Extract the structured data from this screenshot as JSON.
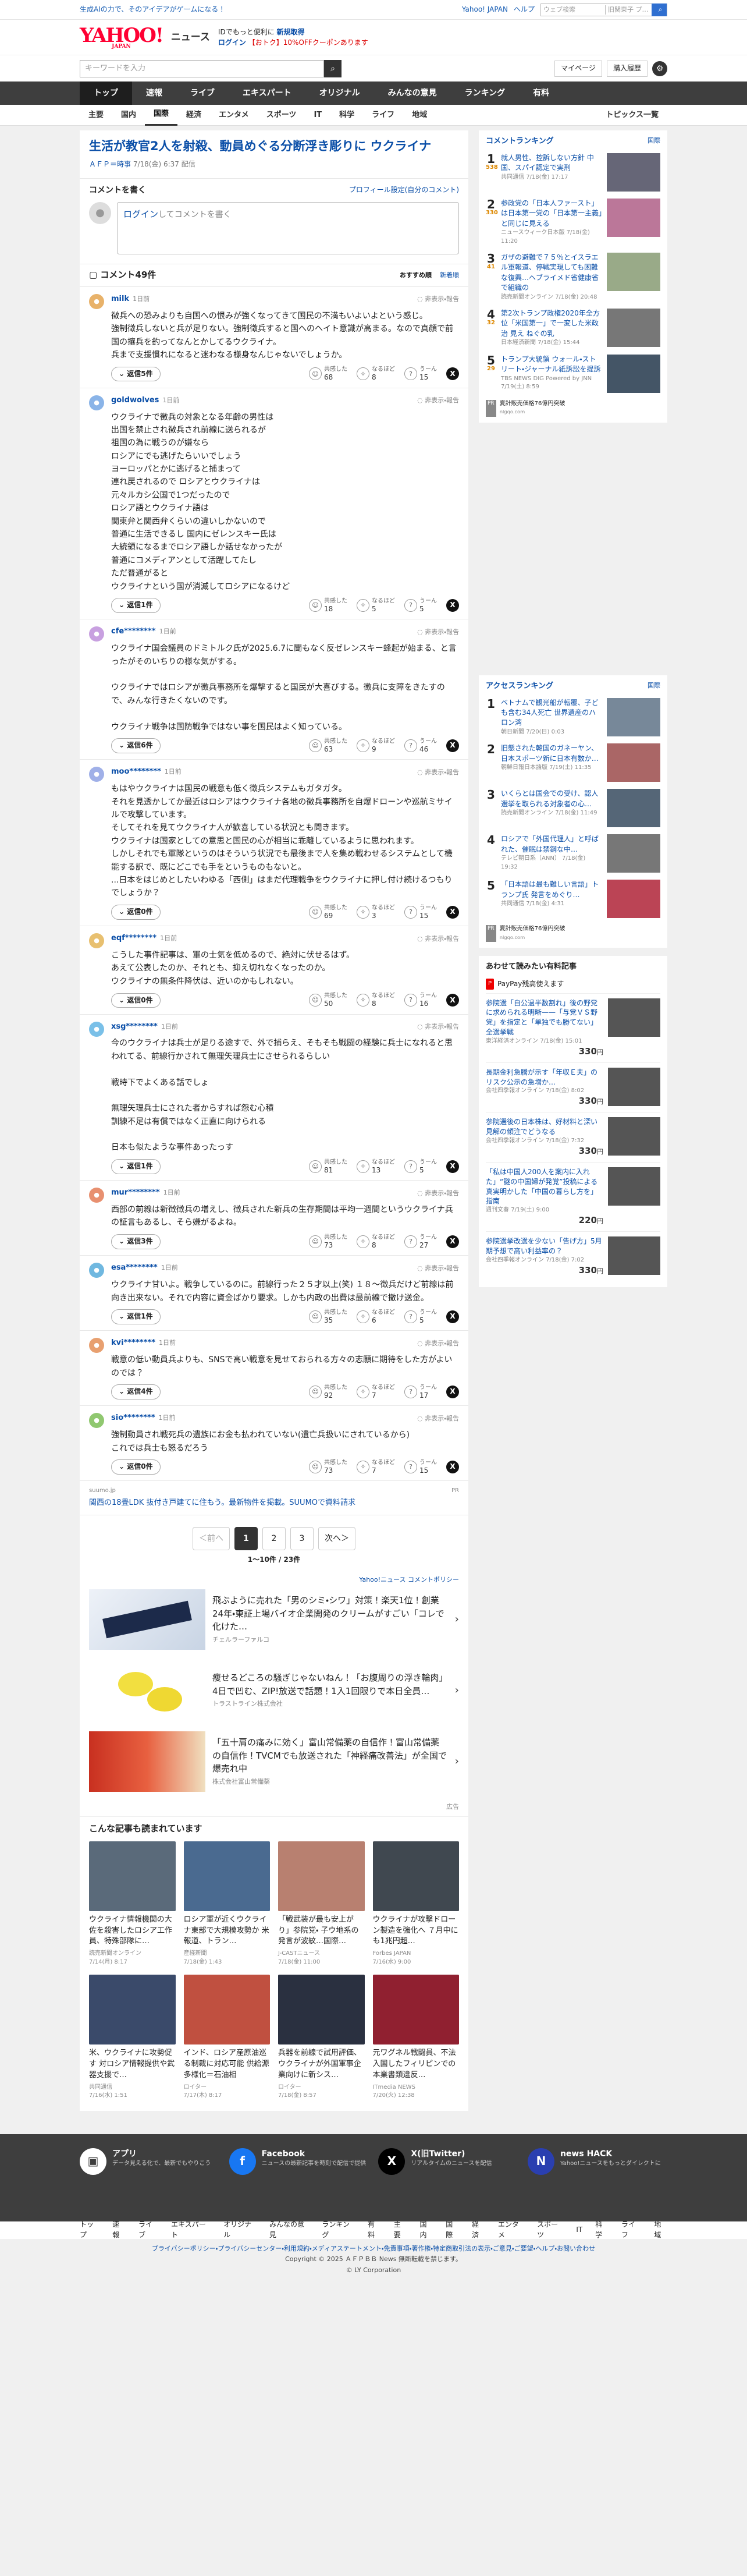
{
  "topbar": {
    "promo": "生成AIの力で、そのアイデアがゲームになる！",
    "yj": "Yahoo! JAPAN",
    "help": "ヘルプ",
    "search_placeholder": "ウェブ検索",
    "search_placeholder2": "旧関東子 プ…"
  },
  "header": {
    "logo": "YAHOO!",
    "logo_sub_small": "JAPAN",
    "service": "ニュース",
    "line1_a": "IDでもっと便利に",
    "line1_b": "新規取得",
    "line2_a": "ログイン",
    "line2_b": "【おトク】10%OFFクーポンあります"
  },
  "searchrow": {
    "placeholder": "キーワードを入力",
    "mypage": "マイページ",
    "buy": "購入履歴",
    "icons": {
      "search": "search-icon",
      "gear": "gear-icon"
    }
  },
  "nav": [
    "トップ",
    "速報",
    "ライブ",
    "エキスパート",
    "オリジナル",
    "みんなの意見",
    "ランキング",
    "有料"
  ],
  "subnav": [
    "主要",
    "国内",
    "国際",
    "経済",
    "エンタメ",
    "スポーツ",
    "IT",
    "科学",
    "ライフ",
    "地域"
  ],
  "subnav_more": "トピックス一覧",
  "article": {
    "title": "生活が教官2人を射殺、動員めぐる分断浮き彫りに ウクライナ",
    "source": "ＡＦＰ＝時事",
    "time": "7/18(金) 6:37 配信"
  },
  "comment_write": {
    "title": "コメントを書く",
    "profile": "プロフィール設定(自分のコメント)",
    "login": "ログイン",
    "rest": "してコメントを書く"
  },
  "clist": {
    "count": "コメント49件",
    "sort1": "おすすめ順",
    "sort2": "新着順"
  },
  "labels": {
    "reply": "返信",
    "report": "非表示・報告",
    "r1": "共感した",
    "r2": "なるほど",
    "r3": "うーん"
  },
  "comments": [
    {
      "name": "milk",
      "ago": "1日前",
      "text": "徴兵への恐みよりも自国への恨みが強くなってきて国民の不満もいよいよという感じ。\n強制徴兵しないと兵が足りない。強制徴兵すると国へのヘイト意識が高まる。なので真顔で前国の攘兵を釣ってなんとかしてるウクライナ。\n兵まで支援慣れになると迷わなる様身なんじゃないでしょうか。",
      "replies": "返信5件",
      "a": "68",
      "b": "8",
      "c": "15",
      "color": "#e8b26a"
    },
    {
      "name": "goldwolves",
      "ago": "1日前",
      "text": "ウクライナで徴兵の対象となる年齢の男性は\n出国を禁止され徴兵され前線に送られるが\n祖国の為に戦うのが嫌なら\nロシアにでも逃げたらいいでしょう\nヨーロッパとかに逃げると捕まって\n連れ戻されるので ロシアとウクライナは\n元々ルカシ公国で1つだったので\nロシア語とウクライナ語は\n関東弁と関西弁くらいの違いしかないので\n普通に生活できるし 国内にゼレンスキー氏は\n大統領になるまでロシア語しか話せなかったが\n普通にコメディアンとして活躍してたし\nただ普通がると\nウクライナという国が消滅してロシアになるけど",
      "replies": "返信1件",
      "a": "18",
      "b": "5",
      "c": "5",
      "color": "#8ab4e8"
    },
    {
      "name": "cfe********",
      "ago": "1日前",
      "text": "ウクライナ国会議員のドミトルク氏が2025.6.7に聞もなく反ゼレンスキー蜂起が始まる、と言ったがそのいちりの様な気がする。\n\nウクライナではロシアが徴兵事務所を爆撃すると国民が大喜びする。徴兵に支障をきたすので、みんな行きたくないのです。\n\nウクライナ戦争は国防戦争ではない事を国民はよく知っている。",
      "replies": "返信6件",
      "a": "63",
      "b": "9",
      "c": "46",
      "color": "#c8a0e0"
    },
    {
      "name": "moo********",
      "ago": "1日前",
      "text": "もはやウクライナは国民の戦意も低く徴兵システムもガタガタ。\nそれを見透かしてか最近はロシアはウクライナ各地の徴兵事務所を自爆ドローンや巡航ミサイルで攻撃しています。\nそしてそれを見てウクライナ人が歓喜している状況とも聞きます。\nウクライナは国家としての意思と国民の心が相当に乖離しているように思われます。\nしかしそれでも軍隊というのはそういう状況でも最後まで人を集め戦わせるシステムとして機能する訳で、既にどこでも手をというものもないと。\n...日本をはじめとしたいわゆる「西側」はまだ代理戦争をウクライナに押し付け続けるつもりでしょうか？",
      "replies": "返信0件",
      "a": "69",
      "b": "3",
      "c": "15",
      "color": "#a0b0e8"
    },
    {
      "name": "eqf********",
      "ago": "1日前",
      "text": "こうした事件記事は、軍の士気を低めるので、絶対に伏せるはず。\nあえて公表したのか、それとも、抑え切れなくなったのか。\nウクライナの無条件降伏は、近いのかもしれない。",
      "replies": "返信0件",
      "a": "50",
      "b": "8",
      "c": "16",
      "color": "#e8c070"
    },
    {
      "name": "xsg********",
      "ago": "1日前",
      "text": "今のウクライナは兵士が足りる途すで、外で捕らえ、そもそも戦闘の経験に兵士になれると思われてる、前線行かされて無理矢理兵士にさせられるらしい\n\n戦時下でよくある話でしょ\n\n無理矢理兵士にされた者からすれば怨む心積\n訓練不足は有償ではなく正直に向けられる\n\n日本も似たような事件あったっす",
      "replies": "返信1件",
      "a": "81",
      "b": "13",
      "c": "5",
      "color": "#7ac0e8"
    },
    {
      "name": "mur********",
      "ago": "1日前",
      "text": "西部の前線は新徴徴兵の増えし、徴兵された新兵の生存期間は平均一週間というウクライナ兵の証言もあるし、そら嫌がるよね。",
      "replies": "返信3件",
      "a": "73",
      "b": "8",
      "c": "27",
      "color": "#e89070"
    },
    {
      "name": "esa********",
      "ago": "1日前",
      "text": "ウクライナ甘いよ。戦争しているのに。前線行った２５才以上(笑) １８〜徴兵だけど前線は前向き出来ない。それで内容に資金ばかり要求。しかも内政の出費は最前線で撤け送金。",
      "replies": "返信1件",
      "a": "35",
      "b": "6",
      "c": "5",
      "color": "#70b8e0"
    },
    {
      "name": "kvi********",
      "ago": "1日前",
      "text": "戦意の低い動員兵よりも、SNSで高い戦意を見せておられる方々の志願に期待をした方がよいのでは？",
      "replies": "返信4件",
      "a": "92",
      "b": "7",
      "c": "17",
      "color": "#e8a070"
    },
    {
      "name": "sio********",
      "ago": "1日前",
      "text": "強制動員され戦死兵の遺族にお金も払われていない(遺亡兵扱いにされているから)\nこれでは兵士も怒るだろう",
      "replies": "返信0件",
      "a": "73",
      "b": "7",
      "c": "15",
      "color": "#90c870"
    }
  ],
  "ad1": {
    "name": "suumo.jp",
    "pr": "PR",
    "text": "関西の18畳LDK 抜付き戸建てに住もう。最新物件を掲載。SUUMOで資料請求"
  },
  "pager": {
    "prev": "＜前へ",
    "pages": [
      "1",
      "2",
      "3"
    ],
    "next": "次へ＞",
    "info": "1〜10件 / 23件",
    "policy": "Yahoo!ニュース コメントポリシー"
  },
  "ads": [
    {
      "text": "飛ぶように売れた「男のシミ・シワ」対策！楽天1位！創業24年・東証上場バイオ企業開発のクリームがすごい「コレで化けた…",
      "sponsor": "チェルラーファルコ"
    },
    {
      "text": "痩せるどころの騒ぎじゃないねん！「お腹周りの浮き輪肉」4日で凹む、ZIP!放送で話題！1入1回限りで本日全員…",
      "sponsor": "トラストライン株式会社"
    },
    {
      "text": "「五十肩の痛みに効く」富山常備薬の自信作！富山常備薬の自信作！TVCMでも放送された「神経痛改善法」が全国で爆売れ中",
      "sponsor": "株式会社富山常備薬"
    }
  ],
  "ad_note": "広告",
  "popular": {
    "title": "こんな記事も読まれています",
    "items": [
      {
        "text": "ウクライナ情報機関の大佐を殺害したロシア工作員、特殊部隊に…",
        "src": "読売新聞オンライン",
        "time": "7/14(月) 8:17",
        "color": "#5a6a7a"
      },
      {
        "text": "ロシア軍が近くウクライナ東部で大規模攻勢か 米報道、トラン…",
        "src": "産経新聞",
        "time": "7/18(金) 1:43",
        "color": "#4a6a90"
      },
      {
        "text": "「戦武装が最も安上がり」参院党・ 子ウ地系の発言が波紋…国際…",
        "src": "J-CASTニュース",
        "time": "7/18(金) 11:00",
        "color": "#b88070"
      },
      {
        "text": "ウクライナが攻撃ドローン製造を強化へ ７月中にも1兆円超…",
        "src": "Forbes JAPAN",
        "time": "7/16(水) 9:00",
        "color": "#404850"
      },
      {
        "text": "米、ウクライナに攻勢促す 対ロシア情報提供や武器支援で…",
        "src": "共同通信",
        "time": "7/16(水) 1:51",
        "color": "#3a4a6a"
      },
      {
        "text": "インド、ロシア産原油巡る制裁に対応可能 供給源多様化＝石油相",
        "src": "ロイター",
        "time": "7/17(木) 8:17",
        "color": "#c05040"
      },
      {
        "text": "兵器を前線で試用評価、ウクライナが外国軍事企業向けに新シス…",
        "src": "ロイター",
        "time": "7/18(金) 8:57",
        "color": "#2a3040"
      },
      {
        "text": "元ワグネル戦闘員、不法入国したフィリピンでの本業書類違反…",
        "src": "ITmedia NEWS",
        "time": "7/20(火) 12:38",
        "color": "#902030"
      }
    ]
  },
  "ranking": {
    "title": "コメントランキング",
    "sub": "国際",
    "items": [
      {
        "no": "1",
        "cnt": "538",
        "text": "就人男性、控訴しない方針 中国、スパイ認定で実刑",
        "src": "共同通信",
        "time": "7/18(金) 17:17",
        "color": "#667"
      },
      {
        "no": "2",
        "cnt": "330",
        "text": "参政党の「日本人ファースト」は日本第一党の「日本第一主義」と同じに見える",
        "src": "ニュースウィーク日本版",
        "time": "7/18(金) 11:20",
        "color": "#b79"
      },
      {
        "no": "3",
        "cnt": "41",
        "text": "ガザの避難で７５％とイスラエル軍報道、停戦実現しても困難な復興…ヘブライメド省健康省で組織の",
        "src": "読売新聞オンライン",
        "time": "7/18(金) 20:48",
        "color": "#9a8"
      },
      {
        "no": "4",
        "cnt": "32",
        "text": "第2次トランプ政権2020年全方位「米国第一」で一変した米政治 見え ねぐの乳",
        "src": "日本経済新聞",
        "time": "7/18(金) 15:44",
        "color": "#777"
      },
      {
        "no": "5",
        "cnt": "29",
        "text": "トランプ大統領 ウォール・ストリート・ジャーナル紙訴訟を提訴",
        "src": "TBS NEWS DIG Powered by JNN",
        "time": "7/19(土) 8:59",
        "color": "#456"
      }
    ],
    "ad": "夏計販売価格76億円突破",
    "ad_src": "nlgqo.com"
  },
  "access": {
    "title": "アクセスランキング",
    "sub": "国際",
    "items": [
      {
        "no": "1",
        "text": "ベトナムで観光船が転覆、子ども含む34人死亡 世界遺産のハロン湾",
        "src": "朝日新聞",
        "time": "7/20(日) 0:03",
        "color": "#789"
      },
      {
        "no": "2",
        "text": "旧態された韓国のガネーヤン、日本スポーツ新に日本有数か…",
        "src": "朝鮮日報日本語版",
        "time": "7/19(土) 11:35",
        "color": "#a66"
      },
      {
        "no": "3",
        "text": "いくらとは国会での受け、認人 選挙を取られる対象者の心…",
        "src": "読売新聞オンライン",
        "time": "7/18(金) 11:49",
        "color": "#567"
      },
      {
        "no": "4",
        "text": "ロシアで「外国代理人」と呼ばれた、催眠は禁鋼な中…",
        "src": "テレビ朝日系（ANN）",
        "time": "7/18(金) 19:32",
        "color": "#777"
      },
      {
        "no": "5",
        "text": "「日本語は最も難しい言語」トランプ氏 発言をめぐり…",
        "src": "共同通信",
        "time": "7/18(金) 4:31",
        "color": "#b45"
      }
    ],
    "ad": "夏計販売価格76億円突破",
    "ad_src": "nlgqo.com"
  },
  "shop": {
    "title": "あわせて読みたい有料記事",
    "paypay": "PayPay残高使えます",
    "items": [
      {
        "text": "参院選「自公過半数割れ」後の野党に求められる明晰——「与党ＶＳ野党」を指定と「単独でも勝てない」全選挙戦",
        "src": "東洋経済オンライン",
        "time": "7/18(金) 15:01",
        "price": "330"
      },
      {
        "text": "長期金利急騰が示す「年収Ｅ夫」のリスク公示の急増か…",
        "src": "会社四季報オンライン",
        "time": "7/18(金) 8:02",
        "price": "330"
      },
      {
        "text": "参院選後の日本株は、好材料と深い見解の傾注でどうなる",
        "src": "会社四季報オンライン",
        "time": "7/18(金) 7:32",
        "price": "330"
      },
      {
        "text": "「私は中国人200人を案内に入れた」“謎の中国婦が発覚”投稿による真実明かした「中国の暮らし方を」指南",
        "src": "週刊文春",
        "time": "7/19(土) 9:00",
        "price": "220"
      },
      {
        "text": "参院選挙改選を少ない「告げ方」5月期予想で高い利益率の？",
        "src": "会社四季報オンライン",
        "time": "7/18(金) 7:02",
        "price": "330"
      }
    ],
    "yen": "円"
  },
  "footer": {
    "items": [
      {
        "title": "アプリ",
        "desc": "データ見える化で、最新でもやりこう",
        "icon": "app-icon"
      },
      {
        "title": "Facebook",
        "desc": "ニュースの最新記事を時刻で配信で提供",
        "icon": "facebook-icon"
      },
      {
        "title": "X(旧Twitter)",
        "desc": "リアルタイムのニュースを配信",
        "icon": "x-icon"
      },
      {
        "title": "news HACK",
        "desc": "Yahoo!ニュースをもっとダイレクトに",
        "icon": "newshack-icon"
      }
    ],
    "nav": [
      "トップ",
      "速報",
      "ライブ",
      "エキスパート",
      "オリジナル",
      "みんなの意見",
      "ランキング",
      "有料",
      "主要",
      "国内",
      "国際",
      "経済",
      "エンタメ",
      "スポーツ",
      "IT",
      "科学",
      "ライフ",
      "地域"
    ],
    "links": "プライバシーポリシー・プライバシーセンター・利用規約・メディアステートメント・免責事項・著作権・特定商取引法の表示・ご意見・ご要望・ヘルプ・お問い合わせ",
    "copy1": "Copyright © 2025 ＡＦＰＢＢ News 無断転載を禁じます。",
    "copy2": "© LY Corporation"
  }
}
